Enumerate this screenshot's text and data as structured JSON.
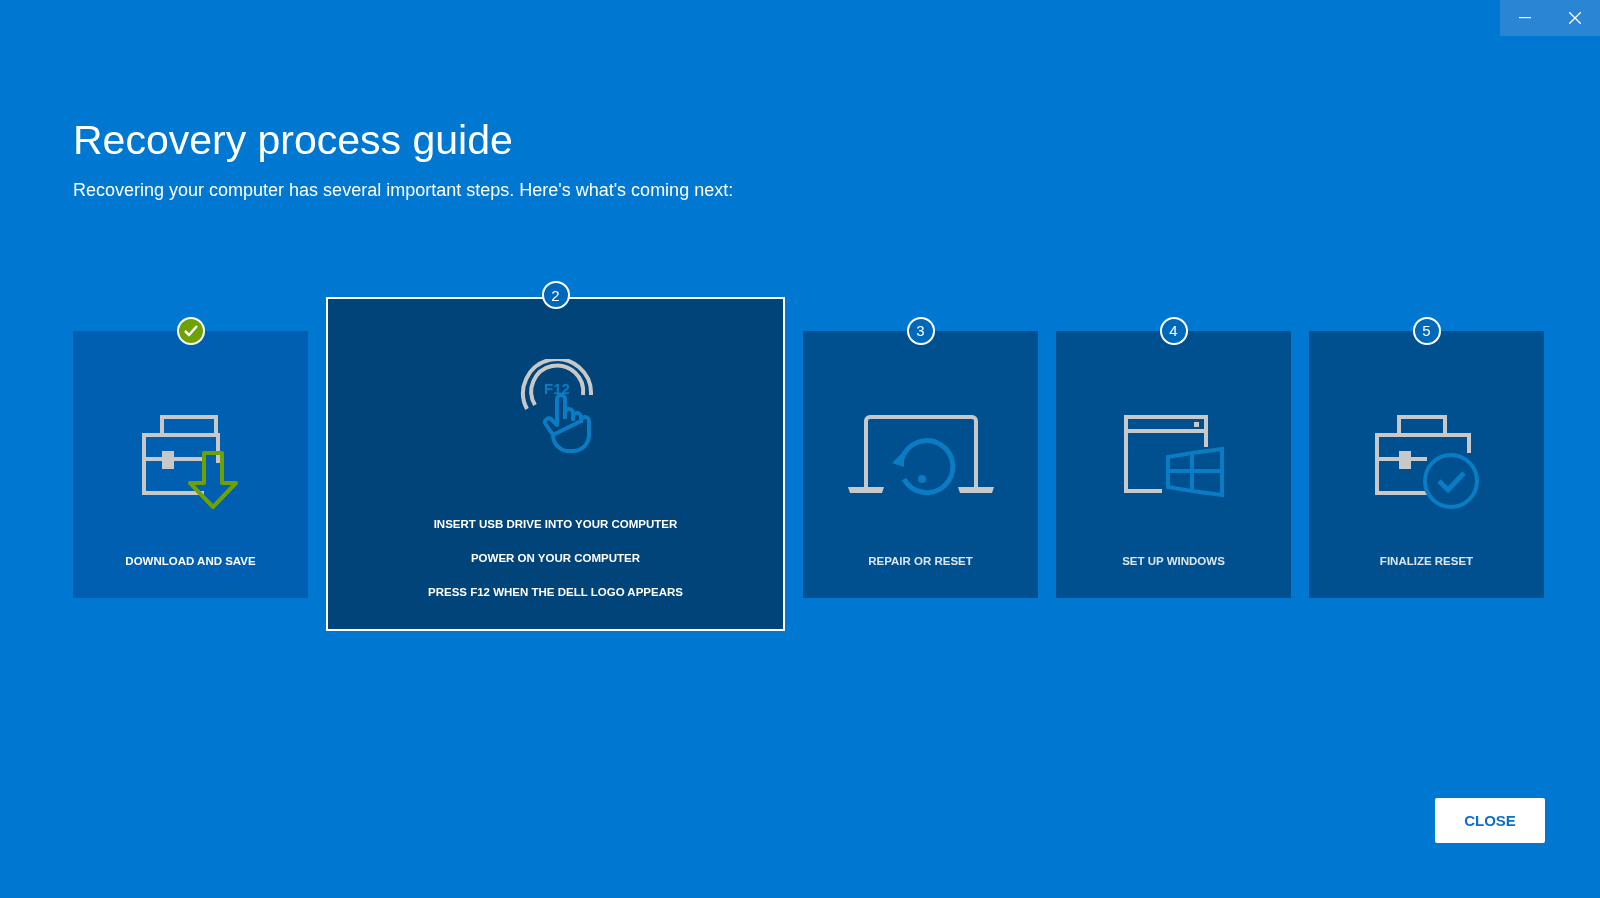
{
  "window_controls": [
    {
      "kind": "minimize"
    },
    {
      "kind": "close"
    }
  ],
  "title": "Recovery process guide",
  "subtitle": "Recovering your computer has several important steps. Here's what's coming next:",
  "steps": [
    {
      "completed": true,
      "selected": false,
      "labels": [
        "DOWNLOAD AND SAVE"
      ]
    },
    {
      "completed": false,
      "selected": true,
      "number": "2",
      "icon_text": "F12",
      "labels": [
        "INSERT USB DRIVE INTO YOUR COMPUTER",
        "POWER ON YOUR COMPUTER",
        "PRESS F12 WHEN THE DELL LOGO APPEARS"
      ]
    },
    {
      "completed": false,
      "selected": false,
      "number": "3",
      "labels": [
        "REPAIR OR RESET"
      ]
    },
    {
      "completed": false,
      "selected": false,
      "number": "4",
      "labels": [
        "SET UP WINDOWS"
      ]
    },
    {
      "completed": false,
      "selected": false,
      "number": "5",
      "labels": [
        "FINALIZE RESET"
      ]
    }
  ],
  "close_button": "CLOSE"
}
